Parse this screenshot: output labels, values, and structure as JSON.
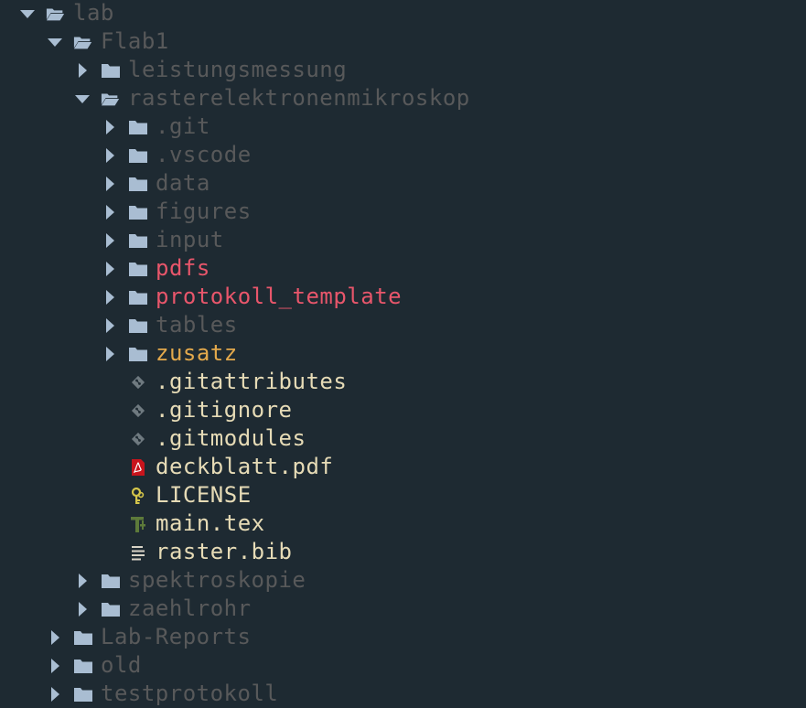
{
  "colors": {
    "background": "#1e2a32",
    "folder": "#a9bdd2",
    "arrow": "#a9bdd2",
    "dim_text": "#58595a",
    "modified_text": "#e8566b",
    "untracked_text": "#e3a94c",
    "file_text": "#e6dbb6",
    "git_icon": "#6f7a80",
    "pdf_icon": "#c8141c",
    "license_icon": "#d4c54a",
    "tex_icon": "#5d7a3a",
    "bib_icon": "#d8d3c6"
  },
  "tree": [
    {
      "label": "lab",
      "depth": 0,
      "kind": "folder",
      "expanded": true,
      "status": "dim"
    },
    {
      "label": "Flab1",
      "depth": 1,
      "kind": "folder",
      "expanded": true,
      "status": "dim"
    },
    {
      "label": "leistungsmessung",
      "depth": 2,
      "kind": "folder",
      "expanded": false,
      "status": "dim"
    },
    {
      "label": "rasterelektronenmikroskop",
      "depth": 2,
      "kind": "folder",
      "expanded": true,
      "status": "dim"
    },
    {
      "label": ".git",
      "depth": 3,
      "kind": "folder",
      "expanded": false,
      "status": "dim"
    },
    {
      "label": ".vscode",
      "depth": 3,
      "kind": "folder",
      "expanded": false,
      "status": "dim"
    },
    {
      "label": "data",
      "depth": 3,
      "kind": "folder",
      "expanded": false,
      "status": "dim"
    },
    {
      "label": "figures",
      "depth": 3,
      "kind": "folder",
      "expanded": false,
      "status": "dim"
    },
    {
      "label": "input",
      "depth": 3,
      "kind": "folder",
      "expanded": false,
      "status": "dim"
    },
    {
      "label": "pdfs",
      "depth": 3,
      "kind": "folder",
      "expanded": false,
      "status": "red"
    },
    {
      "label": "protokoll_template",
      "depth": 3,
      "kind": "folder",
      "expanded": false,
      "status": "red"
    },
    {
      "label": "tables",
      "depth": 3,
      "kind": "folder",
      "expanded": false,
      "status": "dim"
    },
    {
      "label": "zusatz",
      "depth": 3,
      "kind": "folder",
      "expanded": false,
      "status": "orange"
    },
    {
      "label": ".gitattributes",
      "depth": 3,
      "kind": "file",
      "icon": "git-icon",
      "status": "file"
    },
    {
      "label": ".gitignore",
      "depth": 3,
      "kind": "file",
      "icon": "git-icon",
      "status": "file"
    },
    {
      "label": ".gitmodules",
      "depth": 3,
      "kind": "file",
      "icon": "git-icon",
      "status": "file"
    },
    {
      "label": "deckblatt.pdf",
      "depth": 3,
      "kind": "file",
      "icon": "pdf-icon",
      "status": "file"
    },
    {
      "label": "LICENSE",
      "depth": 3,
      "kind": "file",
      "icon": "license-icon",
      "status": "file"
    },
    {
      "label": "main.tex",
      "depth": 3,
      "kind": "file",
      "icon": "tex-icon",
      "status": "file"
    },
    {
      "label": "raster.bib",
      "depth": 3,
      "kind": "file",
      "icon": "bib-icon",
      "status": "file"
    },
    {
      "label": "spektroskopie",
      "depth": 2,
      "kind": "folder",
      "expanded": false,
      "status": "dim"
    },
    {
      "label": "zaehlrohr",
      "depth": 2,
      "kind": "folder",
      "expanded": false,
      "status": "dim"
    },
    {
      "label": "Lab-Reports",
      "depth": 1,
      "kind": "folder",
      "expanded": false,
      "status": "dim"
    },
    {
      "label": "old",
      "depth": 1,
      "kind": "folder",
      "expanded": false,
      "status": "dim"
    },
    {
      "label": "testprotokoll",
      "depth": 1,
      "kind": "folder",
      "expanded": false,
      "status": "dim"
    }
  ]
}
